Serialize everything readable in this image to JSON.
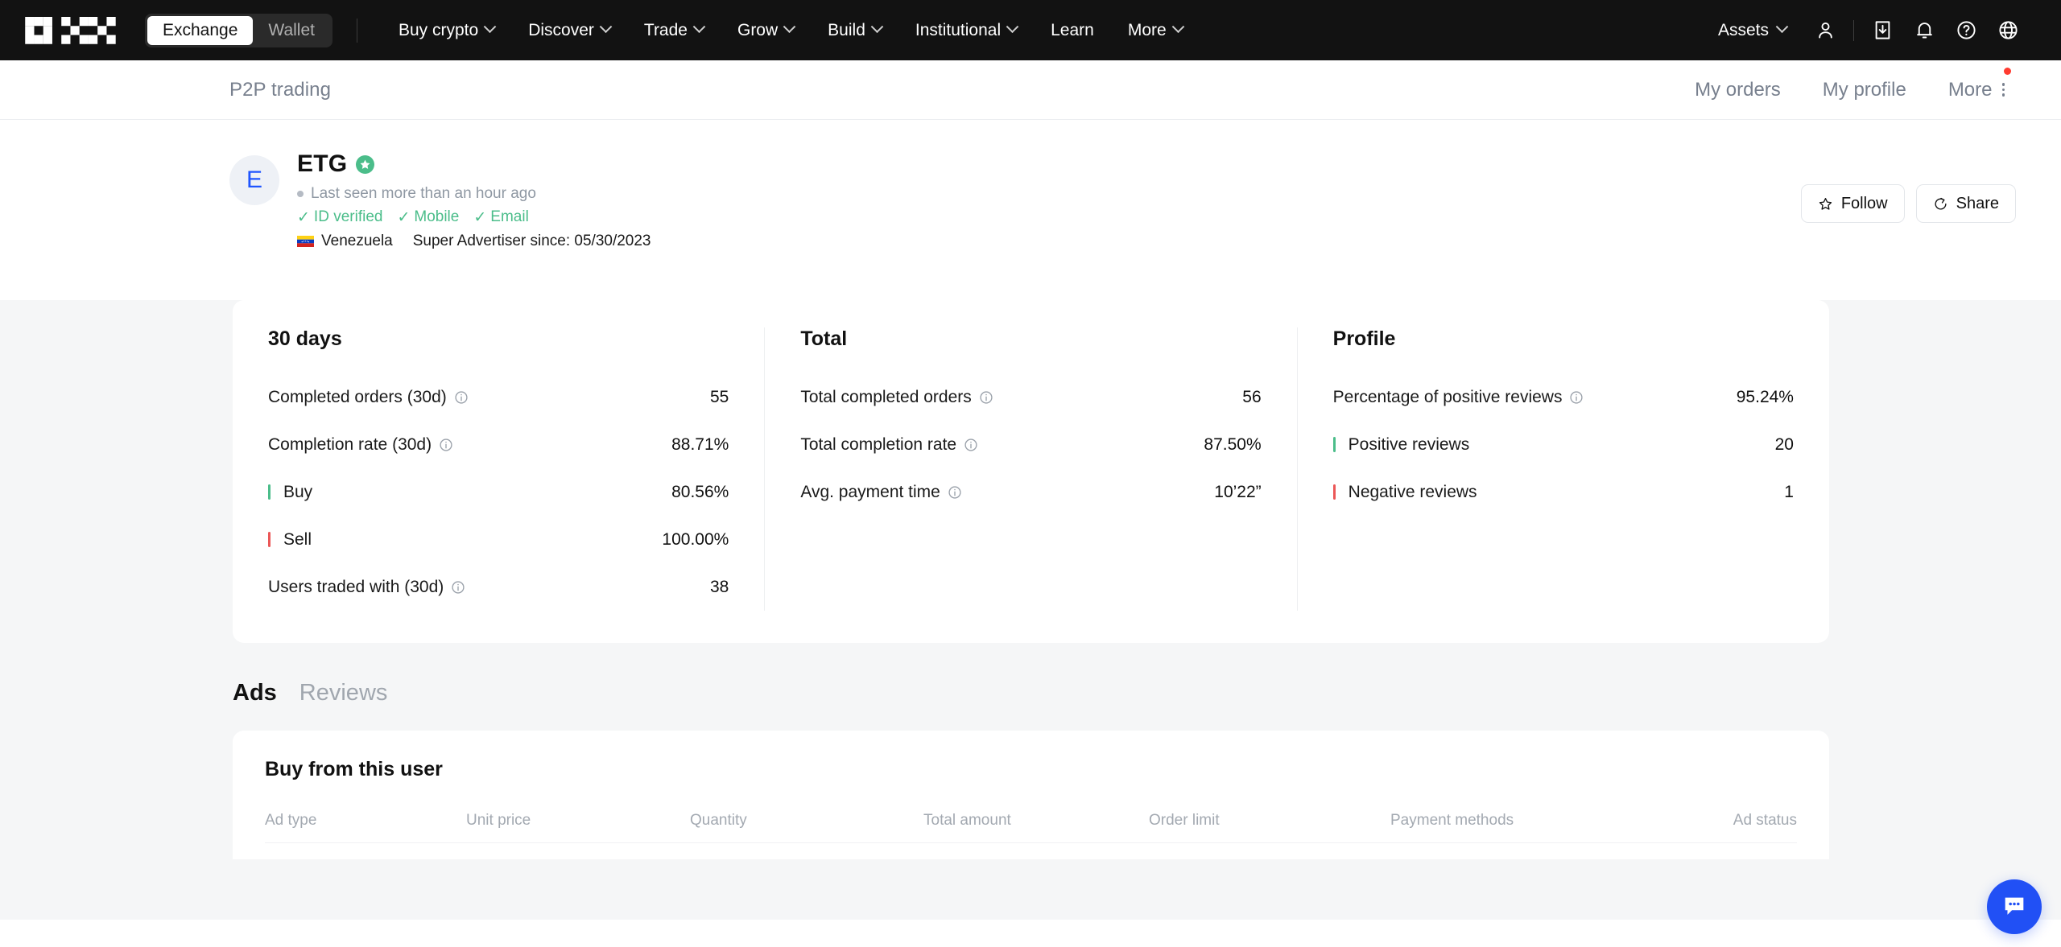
{
  "topnav": {
    "logo_name": "okx-logo",
    "toggle": {
      "exchange": "Exchange",
      "wallet": "Wallet",
      "active": "Exchange"
    },
    "links": [
      {
        "label": "Buy crypto",
        "has_chevron": true
      },
      {
        "label": "Discover",
        "has_chevron": true
      },
      {
        "label": "Trade",
        "has_chevron": true
      },
      {
        "label": "Grow",
        "has_chevron": true
      },
      {
        "label": "Build",
        "has_chevron": true
      },
      {
        "label": "Institutional",
        "has_chevron": true
      },
      {
        "label": "Learn",
        "has_chevron": false
      },
      {
        "label": "More",
        "has_chevron": true
      }
    ],
    "assets_label": "Assets",
    "icons": [
      "user-icon",
      "download-icon",
      "bell-icon",
      "help-icon",
      "globe-icon"
    ]
  },
  "subheader": {
    "title": "P2P trading",
    "links": [
      "My orders",
      "My profile"
    ],
    "more_label": "More",
    "has_notification_dot": true
  },
  "profile": {
    "avatar_initial": "E",
    "name": "ETG",
    "badge": "super-advertiser-star",
    "last_seen": "Last seen more than an hour ago",
    "verifications": [
      "ID verified",
      "Mobile",
      "Email"
    ],
    "country": "Venezuela",
    "country_flag": "🇻🇪",
    "super_advertiser_since": "Super Advertiser since: 05/30/2023",
    "follow_label": "Follow",
    "share_label": "Share"
  },
  "stats": {
    "columns": [
      {
        "title": "30 days",
        "rows": [
          {
            "label": "Completed orders (30d)",
            "value": "55",
            "info": true,
            "bar": ""
          },
          {
            "label": "Completion rate (30d)",
            "value": "88.71%",
            "info": true,
            "bar": ""
          },
          {
            "label": "Buy",
            "value": "80.56%",
            "info": false,
            "bar": "green"
          },
          {
            "label": "Sell",
            "value": "100.00%",
            "info": false,
            "bar": "red"
          },
          {
            "label": "Users traded with (30d)",
            "value": "38",
            "info": true,
            "bar": ""
          }
        ]
      },
      {
        "title": "Total",
        "rows": [
          {
            "label": "Total completed orders",
            "value": "56",
            "info": true,
            "bar": ""
          },
          {
            "label": "Total completion rate",
            "value": "87.50%",
            "info": true,
            "bar": ""
          },
          {
            "label": "Avg. payment time",
            "value": "10’22”",
            "info": true,
            "bar": ""
          }
        ]
      },
      {
        "title": "Profile",
        "rows": [
          {
            "label": "Percentage of positive reviews",
            "value": "95.24%",
            "info": true,
            "bar": ""
          },
          {
            "label": "Positive reviews",
            "value": "20",
            "info": false,
            "bar": "green"
          },
          {
            "label": "Negative reviews",
            "value": "1",
            "info": false,
            "bar": "red"
          }
        ]
      }
    ]
  },
  "tabs": {
    "items": [
      "Ads",
      "Reviews"
    ],
    "active": "Ads"
  },
  "ads": {
    "title": "Buy from this user",
    "headers": [
      "Ad type",
      "Unit price",
      "Quantity",
      "Total amount",
      "Order limit",
      "Payment methods",
      "Ad status"
    ]
  },
  "chat": {
    "name": "chat-widget"
  },
  "colors": {
    "nav_bg": "#121212",
    "page_bg": "#f5f6f7",
    "accent_green": "#4bbd8a",
    "accent_red": "#eb5757",
    "brand_blue": "#2150f5",
    "muted_text": "#78808e"
  }
}
